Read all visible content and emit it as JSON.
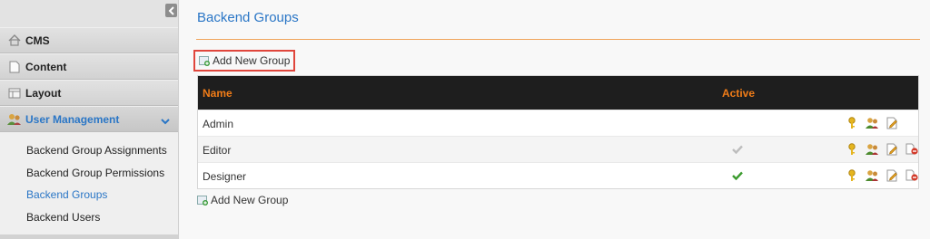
{
  "sidebar": {
    "items": [
      {
        "label": "CMS",
        "icon": "home-icon"
      },
      {
        "label": "Content",
        "icon": "page-icon"
      },
      {
        "label": "Layout",
        "icon": "layout-icon"
      },
      {
        "label": "User Management",
        "icon": "users-icon",
        "active": true
      }
    ],
    "subitems": [
      {
        "label": "Backend Group Assignments"
      },
      {
        "label": "Backend Group Permissions"
      },
      {
        "label": "Backend Groups",
        "current": true
      },
      {
        "label": "Backend Users"
      }
    ],
    "accent_color": "#2a76c6"
  },
  "main": {
    "title": "Backend Groups",
    "add_label": "Add New Group",
    "table": {
      "columns": [
        "Name",
        "Active"
      ],
      "rows": [
        {
          "name": "Admin",
          "active": null,
          "actions": [
            "key-icon",
            "group-users-icon",
            "edit-icon"
          ]
        },
        {
          "name": "Editor",
          "active": "inactive",
          "actions": [
            "key-icon",
            "group-users-icon",
            "edit-icon",
            "delete-icon"
          ]
        },
        {
          "name": "Designer",
          "active": "active",
          "actions": [
            "key-icon",
            "group-users-icon",
            "edit-icon",
            "delete-icon"
          ]
        }
      ]
    },
    "header_color": "#1e1e1e",
    "header_text_color": "#f07c18"
  }
}
